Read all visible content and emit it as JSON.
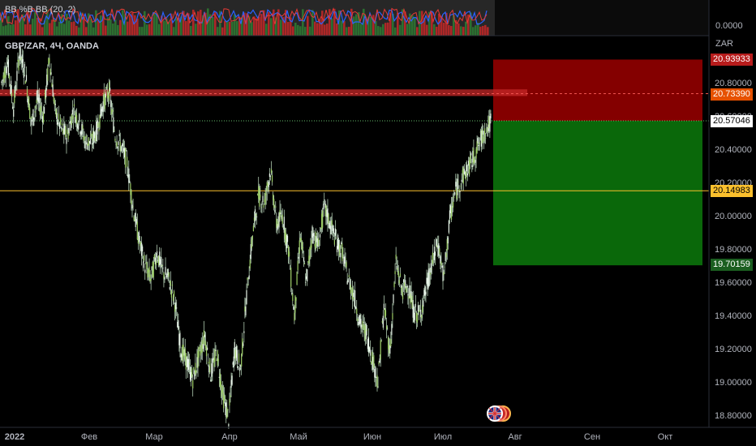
{
  "indicator": {
    "title": "BB %B BB (20, 2)"
  },
  "symbol": {
    "title": "GBP/ZAR, 4Ч, OANDA"
  },
  "currency": "ZAR",
  "indicator_axis": {
    "label": "0.0000"
  },
  "price_axis": {
    "ticks": [
      "20.80000",
      "20.60000",
      "20.40000",
      "20.20000",
      "20.00000",
      "19.80000",
      "19.60000",
      "19.40000",
      "19.20000",
      "19.00000",
      "18.80000"
    ]
  },
  "price_labels": {
    "target": {
      "text": "20.93933",
      "color": "#b71c1c"
    },
    "resistance": {
      "text": "20.73390",
      "color": "#e65100"
    },
    "current": {
      "text": "20.57046",
      "color": "#ffffff"
    },
    "support": {
      "text": "20.14983",
      "color": "#fbc02d"
    },
    "stop": {
      "text": "19.70159",
      "color": "#1b5e20"
    }
  },
  "time_axis": {
    "labels": [
      "2022",
      "Фев",
      "Мар",
      "Апр",
      "Май",
      "Июн",
      "Июл",
      "Авг",
      "Сен",
      "Окт"
    ]
  },
  "chart_data": {
    "type": "line",
    "series": [
      {
        "values": [
          20.8,
          20.92,
          20.65,
          20.98,
          20.85,
          20.55,
          20.7,
          20.6,
          20.95,
          20.62,
          20.52,
          20.48,
          20.64,
          20.56,
          20.45,
          20.44,
          20.52,
          20.68,
          20.75,
          20.48,
          20.42,
          20.32,
          20.05,
          19.85,
          19.7,
          19.62,
          19.78,
          19.66,
          19.62,
          19.48,
          19.2,
          19.12,
          19.02,
          19.15,
          19.28,
          19.05,
          19.18,
          18.92,
          18.78,
          19.2,
          19.08,
          19.52,
          19.88,
          20.12,
          20.08,
          20.28,
          19.95,
          20.0,
          19.8,
          19.4,
          19.88,
          19.6,
          19.9,
          19.82,
          20.05,
          19.95,
          19.85,
          19.78,
          19.62,
          19.52,
          19.35,
          19.3,
          19.15,
          19.0,
          19.45,
          19.18,
          19.72,
          19.55,
          19.58,
          19.42,
          19.4,
          19.55,
          19.7,
          19.84,
          19.62,
          19.98,
          20.15,
          20.22,
          20.28,
          20.35,
          20.44,
          20.52,
          20.57
        ]
      }
    ],
    "ylim": [
      18.75,
      20.98
    ],
    "x_axis_labels": [
      "2022",
      "Фев",
      "Мар",
      "Апр",
      "Май",
      "Июн",
      "Июл",
      "Авг",
      "Сен",
      "Окт"
    ],
    "horizontal_levels": [
      20.7339,
      20.57046,
      20.14983
    ],
    "resistance_zone": [
      20.72,
      20.76
    ],
    "position": {
      "entry": 20.57046,
      "target": 20.93933,
      "stop": 19.70159
    },
    "colors": {
      "candles": "#c8e6c9",
      "target_zone": "#b71c1c",
      "stop_zone": "#0b7a0b",
      "support": "#fbc02d",
      "resistance": "#e53935"
    }
  }
}
